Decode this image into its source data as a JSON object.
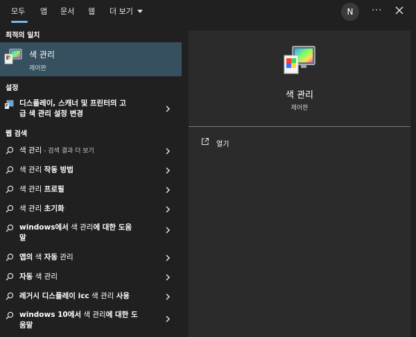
{
  "tabs": [
    "모두",
    "앱",
    "문서",
    "웹",
    "더 보기"
  ],
  "avatar_initial": "N",
  "more_label": "···",
  "sections": {
    "best_match": "최적의 일치",
    "settings": "설정",
    "web_search": "웹 검색"
  },
  "best_match": {
    "title": "색 관리",
    "subtitle": "제어판"
  },
  "settings_item": {
    "line1": "디스플레이, 스캐너 및 프린터의 고",
    "line2": "급 색 관리 설정 변경"
  },
  "web_items": [
    {
      "plain": "색 관리",
      "bold": "",
      "suffix": " - 검색 결과 더 보기"
    },
    {
      "plain": "색 관리 ",
      "bold": "작동 방법",
      "suffix": ""
    },
    {
      "plain": "색 관리 ",
      "bold": "프로필",
      "suffix": ""
    },
    {
      "plain": "색 관리 ",
      "bold": "초기화",
      "suffix": ""
    },
    {
      "plain": "",
      "bold": "windows에서",
      "after": " 색 관리",
      "bold2": "에 대한 도움",
      "line2": "말"
    },
    {
      "plain": "",
      "bold": "앱의",
      "after": " 색 ",
      "bold2": "자동",
      "after2": " 관리"
    },
    {
      "plain": "",
      "bold": "자동",
      "after": " 색 관리"
    },
    {
      "plain": "",
      "bold": "레거시 디스플레이 icc",
      "after": " 색 관리 ",
      "bold2": "사용"
    },
    {
      "plain": "",
      "bold": "windows 10에서",
      "after": " 색 관리",
      "bold2": "에 대한 도",
      "line2": "움말"
    }
  ],
  "right_panel": {
    "title": "색 관리",
    "subtitle": "제어판",
    "open_label": "열기"
  },
  "colors": {
    "accent": "#76b9ed",
    "selected_bg": "#36505f",
    "panel_bg": "#2b2b2b",
    "bg": "#202020"
  }
}
